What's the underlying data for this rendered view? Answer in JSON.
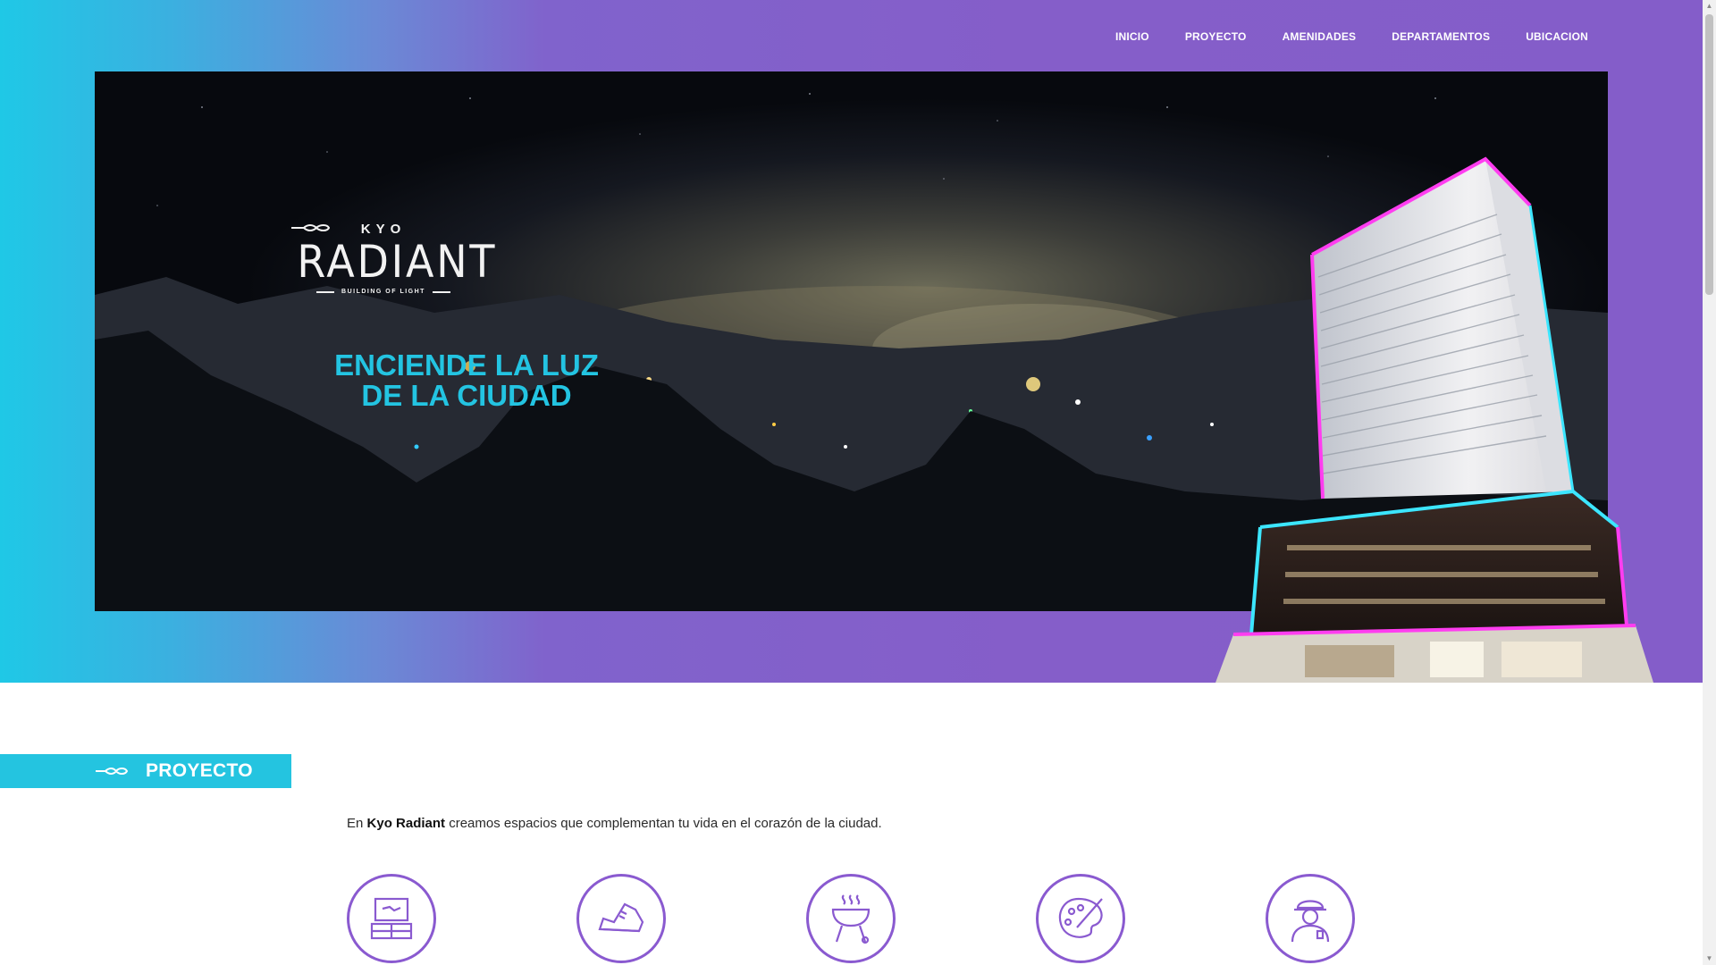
{
  "nav": {
    "items": [
      "INICIO",
      "PROYECTO",
      "AMENIDADES",
      "DEPARTAMENTOS",
      "UBICACION"
    ]
  },
  "hero": {
    "logo_top": "KYO",
    "logo_main": "RADIANT",
    "logo_sub": "BUILDING OF LIGHT",
    "tagline_line1": "ENCIENDE LA LUZ",
    "tagline_line2": "DE LA CIUDAD"
  },
  "project": {
    "title": "PROYECTO",
    "intro_prefix": "En ",
    "intro_brand": "Kyo Radiant",
    "intro_suffix": " creamos espacios que complementan tu vida en el corazón de la ciudad.",
    "amenities": [
      {
        "icon": "tv-furniture-icon"
      },
      {
        "icon": "sneaker-icon"
      },
      {
        "icon": "grill-icon"
      },
      {
        "icon": "paint-palette-icon"
      },
      {
        "icon": "security-guard-icon"
      }
    ]
  },
  "colors": {
    "accent_cyan": "#24c4e0",
    "accent_purple": "#845dc9"
  }
}
